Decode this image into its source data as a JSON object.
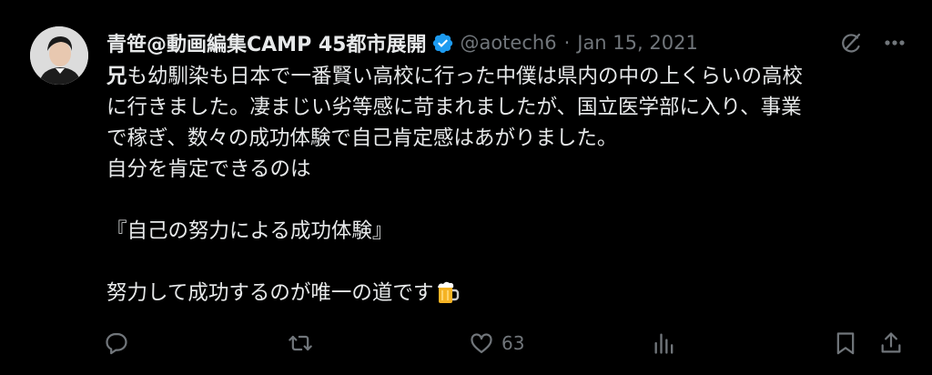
{
  "user": {
    "display_name": "青笹@動画編集CAMP 45都市展開",
    "handle": "@aotech6",
    "separator": "·",
    "date": "Jan 15, 2021"
  },
  "tweet": {
    "lines": [
      {
        "bold": "兄",
        "rest": "も幼馴染も日本で一番賢い高校に行った中僕は県内の中の上くらいの高校"
      },
      {
        "text": "に行きました。凄まじい劣等感に苛まれましたが、国立医学部に入り、事業"
      },
      {
        "text": "で稼ぎ、数々の成功体験で自己肯定感はあがりました。"
      },
      {
        "text": "自分を肯定できるのは"
      },
      {
        "text": ""
      },
      {
        "text": "『自己の努力による成功体験』"
      },
      {
        "text": ""
      },
      {
        "text": "努力して成功するのが唯一の道です"
      }
    ]
  },
  "actions": {
    "likes_count": "63"
  },
  "icons": {
    "verified": "verified-badge-icon",
    "grok": "grok-icon",
    "more": "more-icon",
    "reply": "reply-icon",
    "retweet": "retweet-icon",
    "like": "heart-icon",
    "views": "views-icon",
    "bookmark": "bookmark-icon",
    "share": "share-icon",
    "emoji": "beer-mug-icon"
  },
  "colors": {
    "background": "#000000",
    "text": "#e7e9ea",
    "muted": "#71767b",
    "verified": "#1d9bf0"
  }
}
